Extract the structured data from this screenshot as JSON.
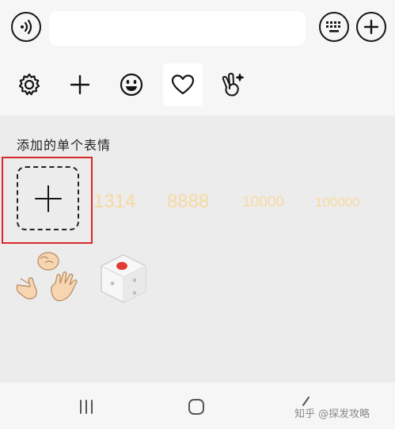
{
  "input_bar": {
    "voice_icon": "voice-icon",
    "keyboard_icon": "keyboard-icon",
    "add_icon": "plus-circle-icon"
  },
  "toolbar": {
    "items": [
      "gear-icon",
      "plus-icon",
      "smiley-icon",
      "heart-icon",
      "hand-gesture-icon"
    ],
    "selected": "heart-icon"
  },
  "panel": {
    "section_title": "添加的单个表情",
    "numbers": [
      "1314",
      "8888",
      "10000",
      "100000"
    ],
    "stickers": [
      "rock-paper-scissors-sticker",
      "dice-sticker"
    ],
    "highlight_color": "#d62828",
    "number_color": "#f7d9a0"
  },
  "nav": {
    "recents_icon": "recents-icon",
    "home_icon": "home-icon",
    "back_icon": "back-icon",
    "watermark": "知乎 @探发攻略"
  }
}
